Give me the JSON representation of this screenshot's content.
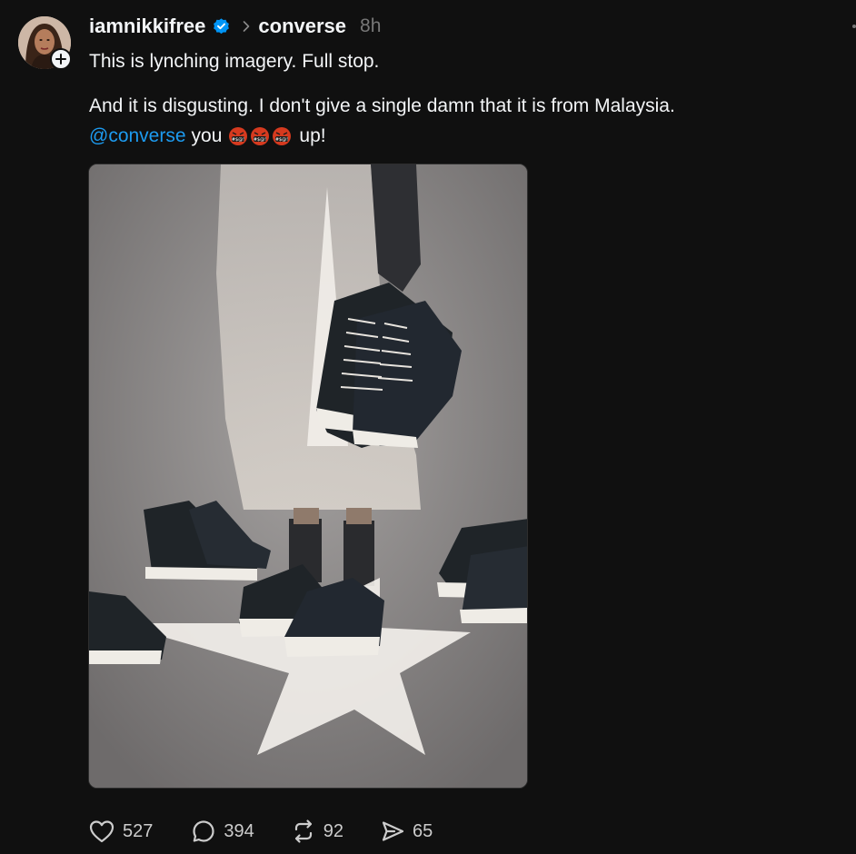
{
  "post": {
    "username": "iamnikkifree",
    "verified": true,
    "community": "converse",
    "time": "8h",
    "line1": "This is lynching imagery. Full stop.",
    "line2": "And it is disgusting. I don't give a single damn that it is from Malaysia.",
    "mention": "@converse",
    "line3_mid": "you",
    "emoji_name": "face-with-symbols-on-mouth",
    "emoji_count": 3,
    "line3_end": "up!",
    "image_description_icon": "photo-shoes-star-light"
  },
  "actions": {
    "likes": "527",
    "replies": "394",
    "reposts": "92",
    "shares": "65"
  },
  "colors": {
    "background": "#101010",
    "text": "#f3f5f7",
    "muted": "#777777",
    "mention": "#1d9bf0",
    "verified": "#0095f6"
  }
}
